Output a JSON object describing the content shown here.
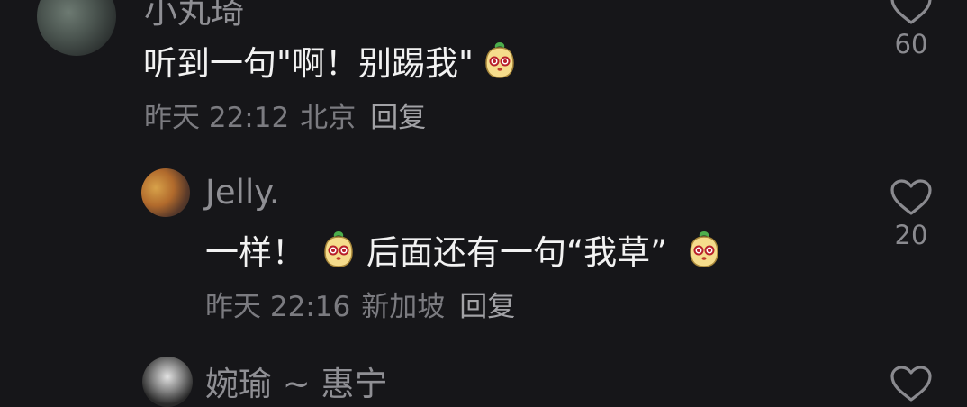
{
  "comments": [
    {
      "username": "小丸琦",
      "text": "听到一句\"啊！别踢我\"",
      "emoji": "bun-face-emoji",
      "time": "昨天 22:12",
      "location": "北京",
      "reply_label": "回复",
      "likes": "60"
    },
    {
      "username": "Jelly.",
      "text_before": "一样！",
      "text_middle": "后面还有一句“我草”",
      "emoji": "bun-face-emoji",
      "time": "昨天 22:16",
      "location": "新加坡",
      "reply_label": "回复",
      "likes": "20"
    },
    {
      "username": "婉瑜 ~ 惠宁"
    }
  ],
  "colors": {
    "background": "#161619",
    "text": "#f2f2f2",
    "muted": "#7b7b80",
    "emoji_fill": "#f5dc8c",
    "emoji_leaf": "#4cae4c"
  }
}
